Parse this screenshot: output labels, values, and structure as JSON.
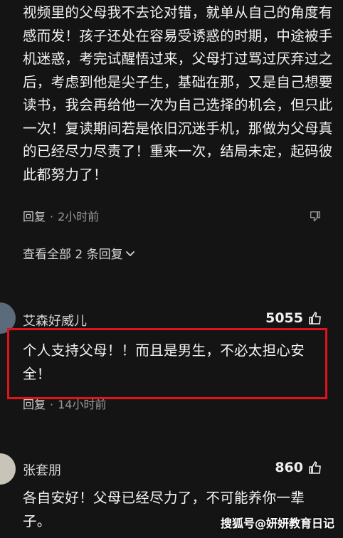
{
  "comment_top": {
    "text": "视频里的父母我不去论对错，就单从自己的角度有感而发！孩子还处在容易受诱惑的时期，中途被手机迷惑，考完试醒悟过来，父母打过骂过厌弃过之后，考虑到他是尖子生，基础在那，又是自己想要读书，我会再给他一次为自己选择的机会，但只此一次！复读期间若是依旧沉迷手机，那做为父母真的已经尽力尽责了！重来一次，结局未定，起码彼此都努力了！",
    "reply_label": "回复",
    "time": "2小时前",
    "dislike_icon": "thumb-down-icon"
  },
  "view_all": "查看全部 2 条回复",
  "comment_2": {
    "username": "艾森好威儿",
    "likes": "5055",
    "text": "个人支持父母！！而且是男生，不必太担心安全！",
    "reply_label": "回复",
    "time": "14小时前",
    "highlight_color": "#e0121c"
  },
  "comment_3": {
    "username": "张套朋",
    "likes": "860",
    "text": "各自安好！父母已经尽力了，不可能养你一辈子。"
  },
  "watermark": "搜狐号@妍妍教育日记"
}
